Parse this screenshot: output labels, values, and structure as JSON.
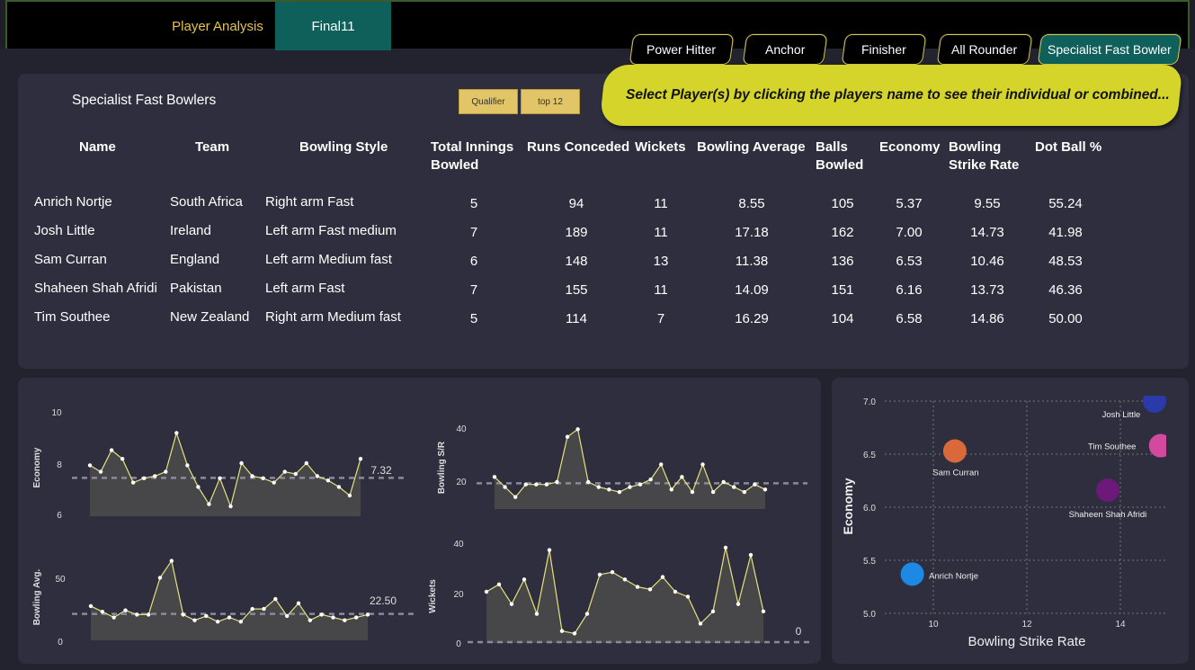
{
  "tabs": {
    "player_analysis": "Player Analysis",
    "final11": "Final11"
  },
  "roles": [
    "Power Hitter",
    "Anchor",
    "Finisher",
    "All Rounder",
    "Specialist Fast Bowler"
  ],
  "banner": "Select Player(s) by clicking the players name to see their individual or combined...",
  "panel_title": "Specialist Fast Bowlers",
  "filters": {
    "qualifier": "Qualifier",
    "top12": "top 12"
  },
  "table": {
    "headers": {
      "name": "Name",
      "team": "Team",
      "style": "Bowling Style",
      "innings_1": "Total Innings",
      "innings_2": "Bowled",
      "runs": "Runs Conceded",
      "wickets": "Wickets",
      "average": "Bowling Average",
      "balls_1": "Balls",
      "balls_2": "Bowled",
      "economy": "Economy",
      "sr_1": "Bowling",
      "sr_2": "Strike Rate",
      "dot": "Dot Ball %"
    },
    "rows": [
      {
        "name": "Anrich Nortje",
        "team": "South Africa",
        "style": "Right arm Fast",
        "innings": "5",
        "runs": "94",
        "wickets": "11",
        "average": "8.55",
        "balls": "105",
        "economy": "5.37",
        "sr": "9.55",
        "dot": "55.24"
      },
      {
        "name": "Josh Little",
        "team": "Ireland",
        "style": "Left arm Fast medium",
        "innings": "7",
        "runs": "189",
        "wickets": "11",
        "average": "17.18",
        "balls": "162",
        "economy": "7.00",
        "sr": "14.73",
        "dot": "41.98"
      },
      {
        "name": "Sam Curran",
        "team": "England",
        "style": "Left arm Medium fast",
        "innings": "6",
        "runs": "148",
        "wickets": "13",
        "average": "11.38",
        "balls": "136",
        "economy": "6.53",
        "sr": "10.46",
        "dot": "48.53"
      },
      {
        "name": "Shaheen Shah Afridi",
        "team": "Pakistan",
        "style": "Left arm Fast",
        "innings": "7",
        "runs": "155",
        "wickets": "11",
        "average": "14.09",
        "balls": "151",
        "economy": "6.16",
        "sr": "13.73",
        "dot": "46.36"
      },
      {
        "name": "Tim Southee",
        "team": "New Zealand",
        "style": "Right arm Medium fast",
        "innings": "5",
        "runs": "114",
        "wickets": "7",
        "average": "16.29",
        "balls": "104",
        "economy": "6.58",
        "sr": "14.86",
        "dot": "50.00"
      }
    ]
  },
  "colors": {
    "accent": "#d4d42a",
    "teal": "#0f5f5a",
    "line": "#e8e27a",
    "area": "#4a4a4a"
  },
  "chart_data": [
    {
      "type": "area",
      "id": "economy",
      "ylabel": "Economy",
      "yticks": [
        "10",
        "8",
        "6"
      ],
      "ylim": [
        5.5,
        10.5
      ],
      "ref_value": 7.32,
      "ref_label": "7.32",
      "values": [
        7.9,
        7.6,
        8.6,
        8.2,
        7.1,
        7.3,
        7.4,
        7.6,
        9.4,
        7.9,
        6.9,
        6.1,
        7.3,
        6.0,
        8.0,
        7.4,
        7.3,
        7.1,
        7.6,
        7.5,
        8.0,
        7.4,
        7.2,
        6.9,
        6.5,
        8.2
      ]
    },
    {
      "type": "area",
      "id": "bowling_sr",
      "ylabel": "Bowling S/R",
      "yticks": [
        "40",
        "20"
      ],
      "ylim": [
        5,
        48
      ],
      "ref_value": 18.5,
      "ref_label": "",
      "values": [
        21,
        17,
        13,
        18,
        18,
        18,
        19,
        37,
        40,
        19,
        17,
        16,
        15,
        17,
        18,
        20,
        26,
        16,
        21,
        15,
        26,
        15,
        19,
        17,
        15,
        18,
        16
      ]
    },
    {
      "type": "area",
      "id": "bowling_avg",
      "ylabel": "Bowling Avg.",
      "yticks": [
        "50",
        "0"
      ],
      "ylim": [
        0,
        75
      ],
      "ref_value": 22.5,
      "ref_label": "22.50",
      "values": [
        28,
        24,
        20,
        25,
        22,
        22,
        48,
        60,
        22,
        18,
        21,
        17,
        20,
        17,
        26,
        26,
        33,
        21,
        30,
        18,
        22,
        20,
        18,
        20,
        22
      ]
    },
    {
      "type": "area",
      "id": "wickets",
      "ylabel": "Wickets",
      "yticks": [
        "40",
        "20",
        "0"
      ],
      "ylim": [
        0,
        44
      ],
      "ref_value": 0,
      "ref_label": "0",
      "values": [
        22,
        25,
        17,
        27,
        13,
        39,
        6,
        5,
        13,
        29,
        30,
        27,
        24,
        23,
        28,
        22,
        20,
        9,
        14,
        40,
        17,
        37,
        14
      ]
    },
    {
      "type": "scatter",
      "id": "sr_vs_economy",
      "xlabel": "Bowling Strike Rate",
      "ylabel": "Economy",
      "xlim": [
        9,
        15
      ],
      "ylim": [
        5,
        7
      ],
      "xticks": [
        "10",
        "12",
        "14"
      ],
      "yticks": [
        "7.0",
        "6.5",
        "6.0",
        "5.5",
        "5.0"
      ],
      "points": [
        {
          "name": "Josh Little",
          "x": 14.73,
          "y": 7.0,
          "color": "#2a3aa8"
        },
        {
          "name": "Tim Southee",
          "x": 14.86,
          "y": 6.58,
          "color": "#d14aa0"
        },
        {
          "name": "Sam Curran",
          "x": 10.46,
          "y": 6.53,
          "color": "#d9683a"
        },
        {
          "name": "Shaheen Shah Afridi",
          "x": 13.73,
          "y": 6.16,
          "color": "#6b1a7a"
        },
        {
          "name": "Anrich Nortje",
          "x": 9.55,
          "y": 5.37,
          "color": "#1e88e5"
        }
      ]
    }
  ]
}
